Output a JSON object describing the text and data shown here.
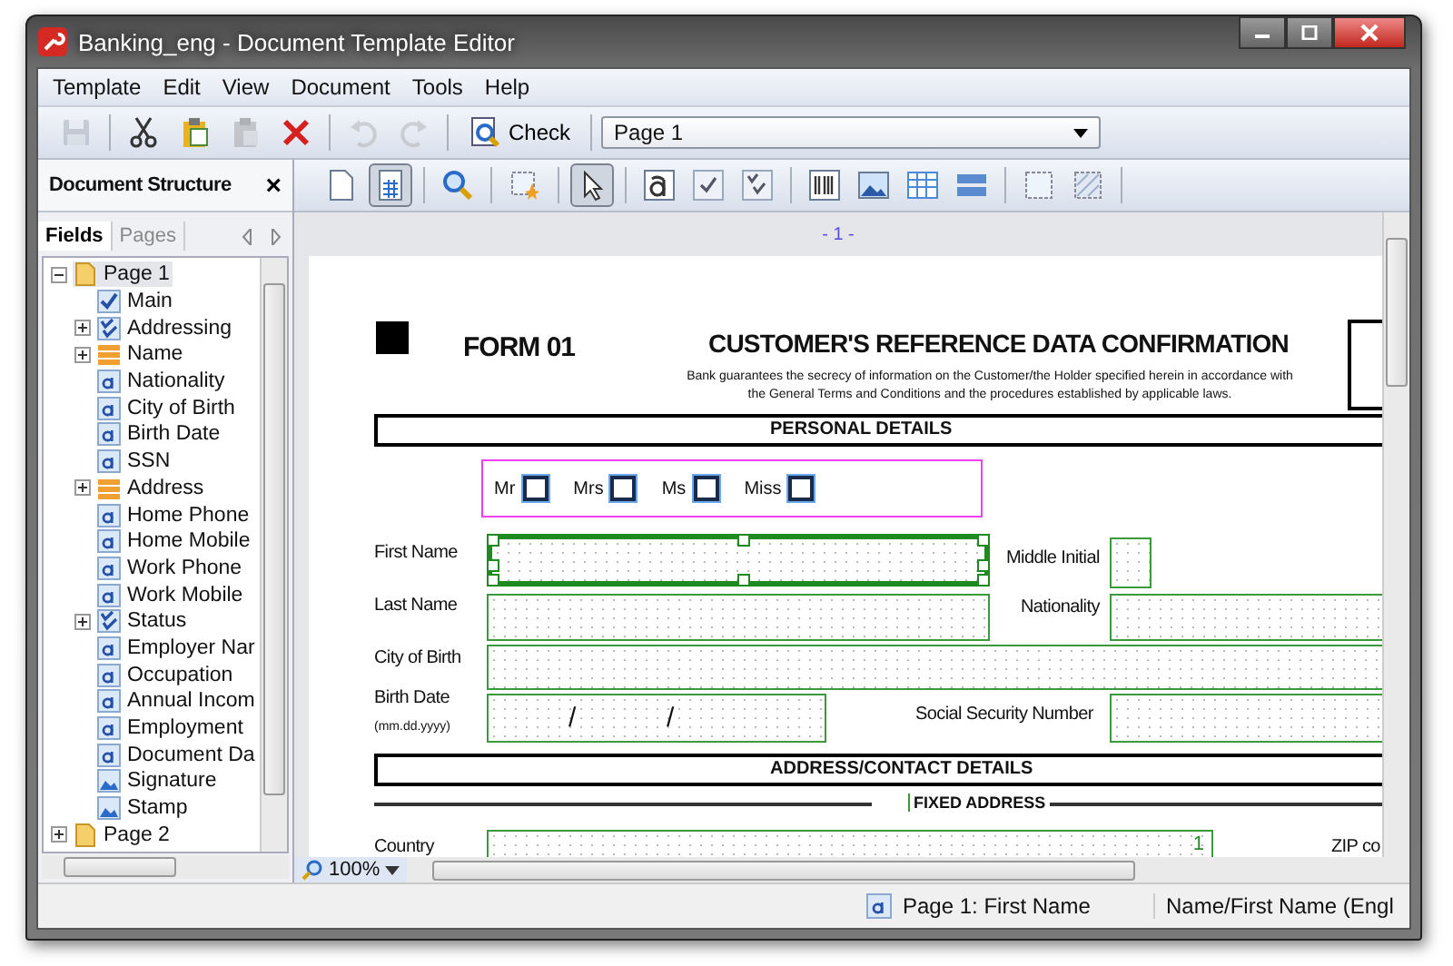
{
  "window": {
    "title": "Banking_eng - Document Template Editor"
  },
  "menu": [
    "Template",
    "Edit",
    "View",
    "Document",
    "Tools",
    "Help"
  ],
  "toolbar": [
    [
      {
        "kind": "save",
        "disabled": true
      }
    ],
    [
      {
        "kind": "cut",
        "disabled": false
      },
      {
        "kind": "clipboard",
        "disabled": false
      },
      {
        "kind": "paste",
        "disabled": true
      },
      {
        "kind": "delete",
        "disabled": false
      }
    ],
    [
      {
        "kind": "undo",
        "disabled": true
      },
      {
        "kind": "redo",
        "disabled": true
      }
    ]
  ],
  "check_button": {
    "label": "Check"
  },
  "page_select": {
    "value": "Page 1"
  },
  "panel": {
    "title": "Document Structure",
    "close": "×"
  },
  "panel_tabs": [
    {
      "label": "Fields",
      "selected": true
    },
    {
      "label": "Pages",
      "selected": false
    }
  ],
  "tree": [
    {
      "label": "Page 1",
      "kind": "page",
      "selected": true,
      "expanded": true,
      "children": [
        {
          "label": "Main",
          "kind": "checkbox",
          "selected": false
        },
        {
          "label": "Addressing",
          "kind": "checkgroup",
          "selected": false,
          "expanded": false
        },
        {
          "label": "Name",
          "kind": "group",
          "selected": false,
          "expanded": false
        },
        {
          "label": "Nationality",
          "kind": "text",
          "selected": false
        },
        {
          "label": "City of Birth",
          "kind": "text",
          "selected": false
        },
        {
          "label": "Birth Date",
          "kind": "text",
          "selected": false
        },
        {
          "label": "SSN",
          "kind": "text",
          "selected": false
        },
        {
          "label": "Address",
          "kind": "group",
          "selected": false,
          "expanded": false
        },
        {
          "label": "Home Phone",
          "kind": "text",
          "selected": false
        },
        {
          "label": "Home Mobile",
          "kind": "text",
          "selected": false
        },
        {
          "label": "Work Phone",
          "kind": "text",
          "selected": false
        },
        {
          "label": "Work Mobile",
          "kind": "text",
          "selected": false
        },
        {
          "label": "Status",
          "kind": "checkgroup",
          "selected": false,
          "expanded": false
        },
        {
          "label": "Employer Nar",
          "kind": "text",
          "selected": false
        },
        {
          "label": "Occupation",
          "kind": "text",
          "selected": false
        },
        {
          "label": "Annual Incom",
          "kind": "text",
          "selected": false
        },
        {
          "label": "Employment",
          "kind": "text",
          "selected": false
        },
        {
          "label": "Document Da",
          "kind": "text",
          "selected": false
        },
        {
          "label": "Signature",
          "kind": "image",
          "selected": false
        },
        {
          "label": "Stamp",
          "kind": "image",
          "selected": false
        }
      ]
    },
    {
      "label": "Page 2",
      "kind": "page",
      "selected": false,
      "expanded": false
    }
  ],
  "doc_toolbar": [
    [
      {
        "kind": "page",
        "selected": false
      },
      {
        "kind": "table-page",
        "selected": true
      }
    ],
    [
      {
        "kind": "zoom",
        "selected": false
      }
    ],
    [
      {
        "kind": "frame-star",
        "selected": false
      }
    ],
    [
      {
        "kind": "pointer",
        "selected": true
      }
    ],
    [
      {
        "kind": "text-field",
        "selected": false
      },
      {
        "kind": "checkbox",
        "selected": false
      },
      {
        "kind": "checkgroup",
        "selected": false
      }
    ],
    [
      {
        "kind": "barcode",
        "selected": false
      },
      {
        "kind": "image",
        "selected": false
      },
      {
        "kind": "table",
        "selected": false
      },
      {
        "kind": "list",
        "selected": false
      }
    ],
    [
      {
        "kind": "frame",
        "selected": false
      },
      {
        "kind": "hatched-frame",
        "selected": false
      }
    ]
  ],
  "page_ruler": "- 1 -",
  "form": {
    "number": "FORM 01",
    "heading": "CUSTOMER'S REFERENCE DATA CONFIRMATION",
    "notice": "Bank guarantees the secrecy of information on the Customer/the Holder specified herein in accordance with the General Terms and Conditions and the procedures established by applicable laws.",
    "section_personal": "PERSONAL DETAILS",
    "salutations": [
      {
        "label": "Mr",
        "checked": false
      },
      {
        "label": "Mrs",
        "checked": false
      },
      {
        "label": "Ms",
        "checked": false
      },
      {
        "label": "Miss",
        "checked": false
      }
    ],
    "first_name": {
      "label": "First Name",
      "selected": true
    },
    "middle_initial": {
      "label": "Middle Initial"
    },
    "last_name": {
      "label": "Last Name"
    },
    "nationality": {
      "label": "Nationality"
    },
    "city_of_birth": {
      "label": "City of Birth"
    },
    "birth_date": {
      "label": "Birth Date",
      "hint": "(mm.dd.yyyy)",
      "separators": [
        "/",
        "/"
      ]
    },
    "ssn": {
      "label": "Social Security Number"
    },
    "section_address": "ADDRESS/CONTACT DETAILS",
    "fixed_address": "FIXED ADDRESS",
    "country": {
      "label": "Country",
      "value": "1"
    },
    "zip": {
      "label": "ZIP co"
    }
  },
  "zoom": {
    "value": "100%"
  },
  "status_bar": {
    "field": "Page 1: First Name",
    "path": "Name/First Name (Engl"
  }
}
